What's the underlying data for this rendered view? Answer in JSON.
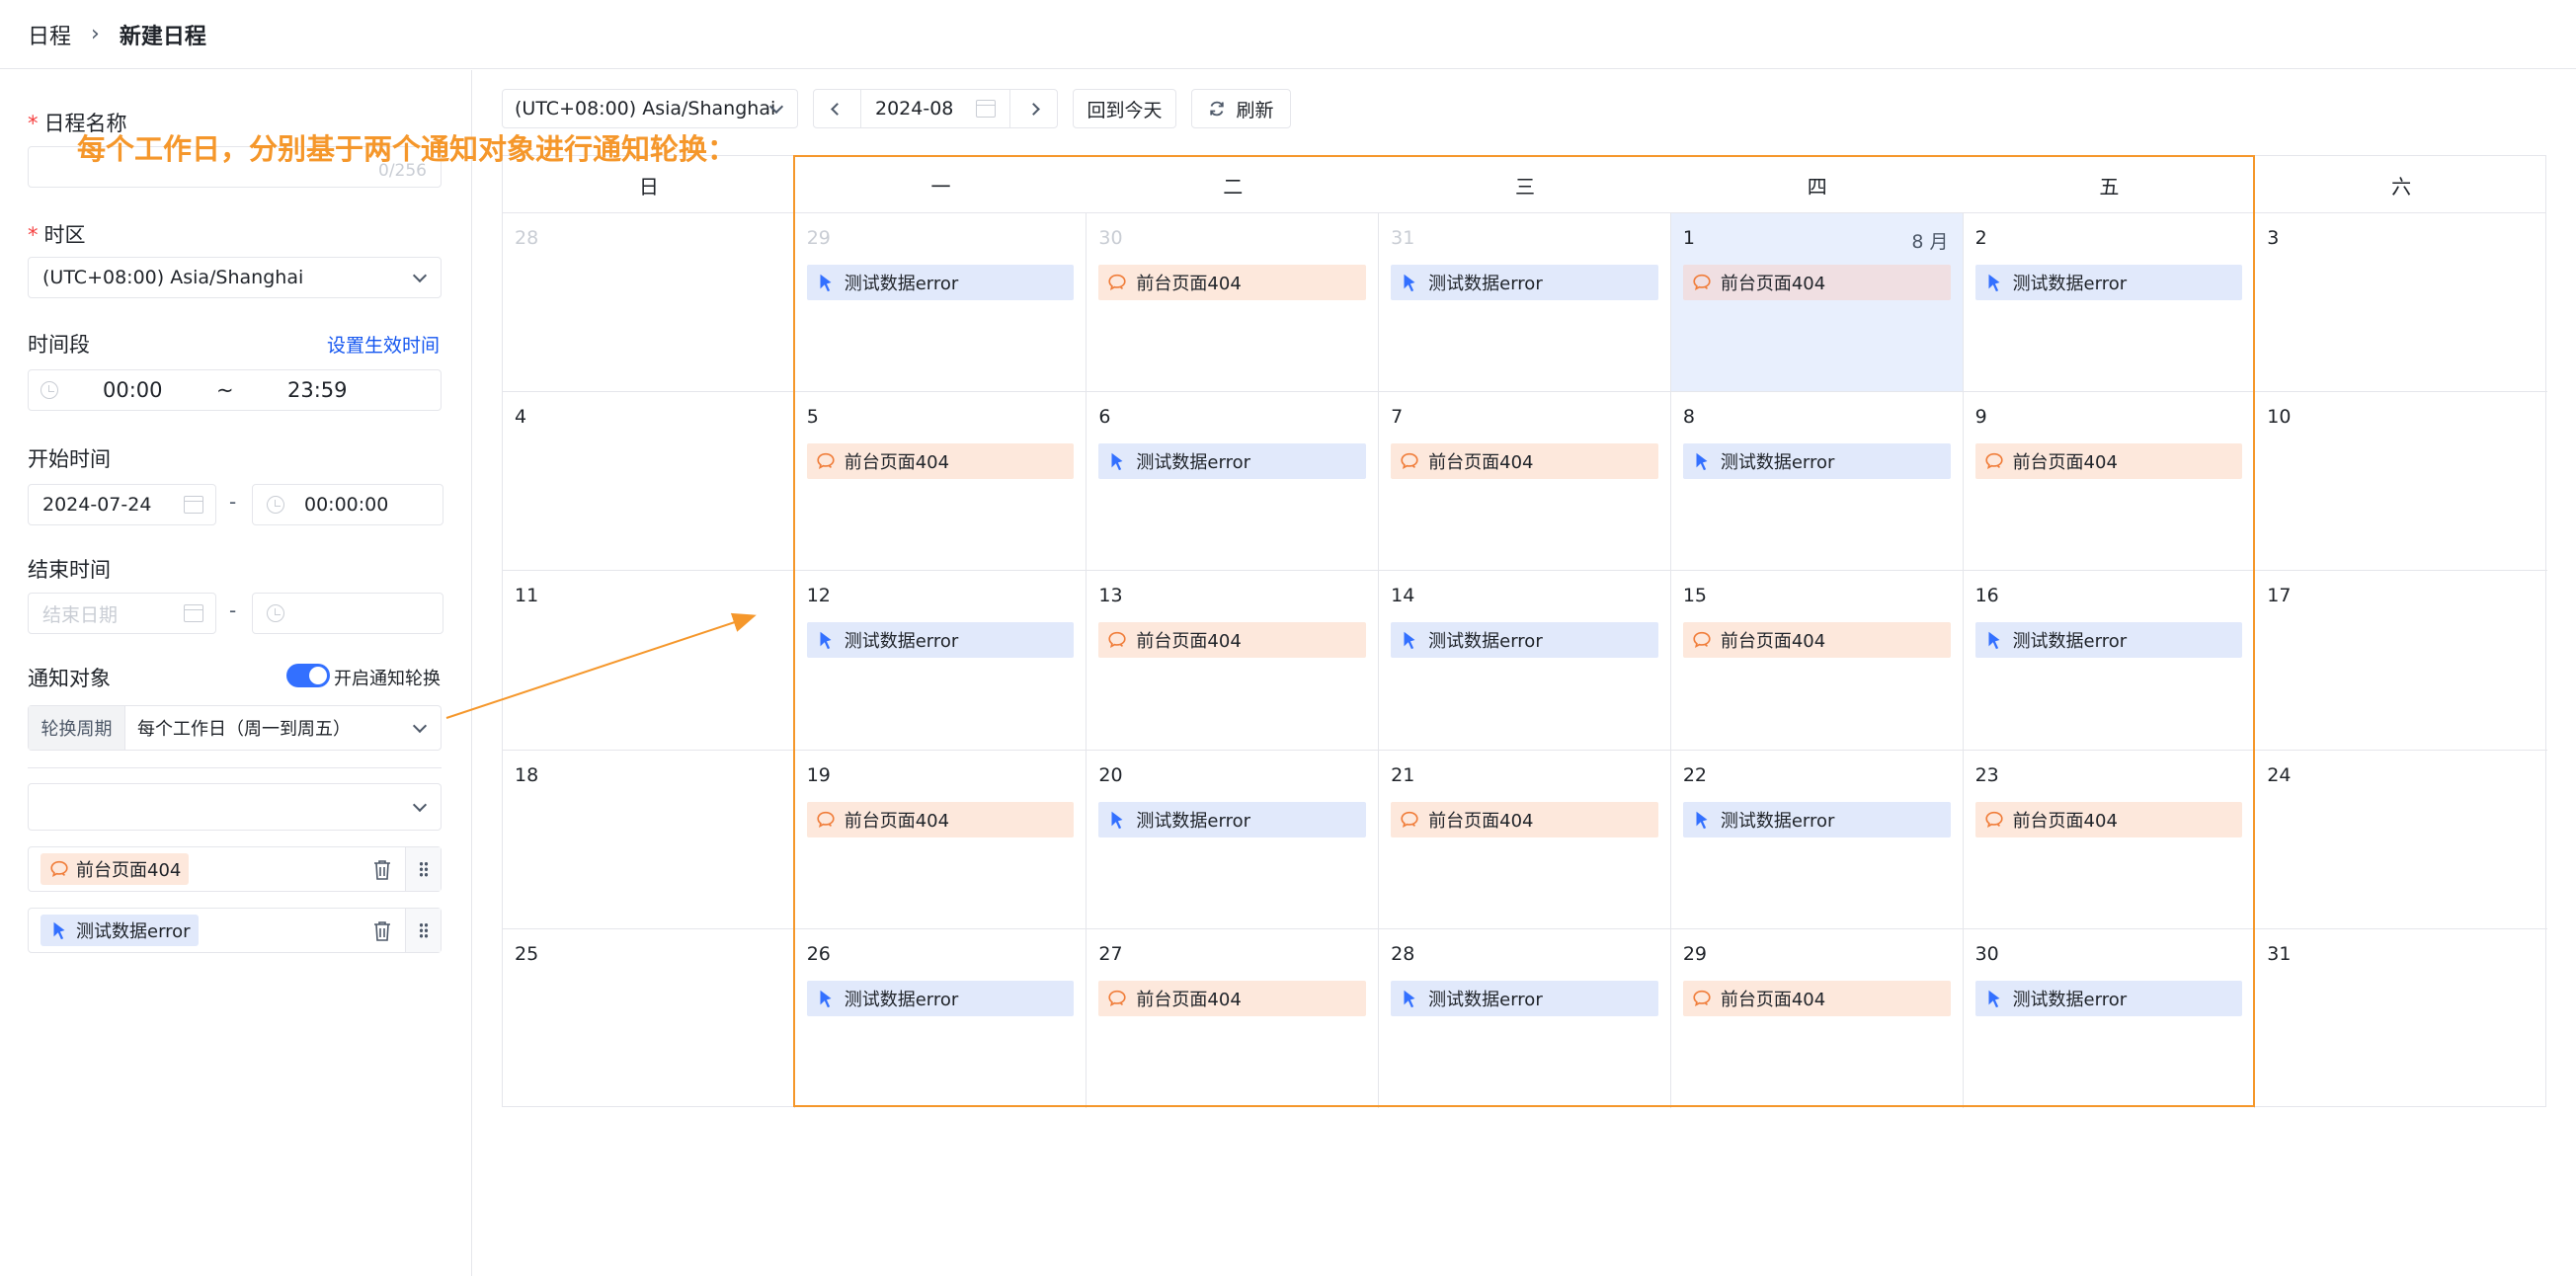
{
  "breadcrumb": {
    "root": "日程",
    "separator": "›",
    "current": "新建日程"
  },
  "form": {
    "name_label": "日程名称",
    "name_counter": "0/256",
    "timezone_label": "时区",
    "timezone_value": "(UTC+08:00) Asia/Shanghai",
    "period_label": "时间段",
    "period_link": "设置生效时间",
    "period_start": "00:00",
    "period_tilde": "~",
    "period_end": "23:59",
    "start_label": "开始时间",
    "start_date": "2024-07-24",
    "start_time": "00:00:00",
    "end_label": "结束时间",
    "end_date_placeholder": "结束日期",
    "dash": "-",
    "notify_label": "通知对象",
    "rotate_toggle_label": "开启通知轮换",
    "rotate_toggle_on": true,
    "cycle_label": "轮换周期",
    "cycle_value": "每个工作日（周一到周五）",
    "members": [
      {
        "name": "前台页面404",
        "kind": "chat",
        "color": "#f07d3a"
      },
      {
        "name": "测试数据error",
        "kind": "bot",
        "color": "#3370ff"
      }
    ]
  },
  "toolbar": {
    "timezone": "(UTC+08:00) Asia/Shanghai",
    "month": "2024-08",
    "today_label": "回到今天",
    "refresh_label": "刷新"
  },
  "annotation": "每个工作日，分别基于两个通知对象进行通知轮换：",
  "calendar": {
    "weekdays": [
      "日",
      "一",
      "二",
      "三",
      "四",
      "五",
      "六"
    ],
    "month_label": "8 月",
    "weeks": [
      [
        {
          "day": "28",
          "muted": true
        },
        {
          "day": "29",
          "muted": true,
          "event": "测试数据error",
          "kind": "bot"
        },
        {
          "day": "30",
          "muted": true,
          "event": "前台页面404",
          "kind": "chat"
        },
        {
          "day": "31",
          "muted": true,
          "event": "测试数据error",
          "kind": "bot"
        },
        {
          "day": "1",
          "today": true,
          "event": "前台页面404",
          "kind": "chat"
        },
        {
          "day": "2",
          "event": "测试数据error",
          "kind": "bot"
        },
        {
          "day": "3"
        }
      ],
      [
        {
          "day": "4"
        },
        {
          "day": "5",
          "event": "前台页面404",
          "kind": "chat"
        },
        {
          "day": "6",
          "event": "测试数据error",
          "kind": "bot"
        },
        {
          "day": "7",
          "event": "前台页面404",
          "kind": "chat"
        },
        {
          "day": "8",
          "event": "测试数据error",
          "kind": "bot"
        },
        {
          "day": "9",
          "event": "前台页面404",
          "kind": "chat"
        },
        {
          "day": "10"
        }
      ],
      [
        {
          "day": "11"
        },
        {
          "day": "12",
          "event": "测试数据error",
          "kind": "bot"
        },
        {
          "day": "13",
          "event": "前台页面404",
          "kind": "chat"
        },
        {
          "day": "14",
          "event": "测试数据error",
          "kind": "bot"
        },
        {
          "day": "15",
          "event": "前台页面404",
          "kind": "chat"
        },
        {
          "day": "16",
          "event": "测试数据error",
          "kind": "bot"
        },
        {
          "day": "17"
        }
      ],
      [
        {
          "day": "18"
        },
        {
          "day": "19",
          "event": "前台页面404",
          "kind": "chat"
        },
        {
          "day": "20",
          "event": "测试数据error",
          "kind": "bot"
        },
        {
          "day": "21",
          "event": "前台页面404",
          "kind": "chat"
        },
        {
          "day": "22",
          "event": "测试数据error",
          "kind": "bot"
        },
        {
          "day": "23",
          "event": "前台页面404",
          "kind": "chat"
        },
        {
          "day": "24"
        }
      ],
      [
        {
          "day": "25"
        },
        {
          "day": "26",
          "event": "测试数据error",
          "kind": "bot"
        },
        {
          "day": "27",
          "event": "前台页面404",
          "kind": "chat"
        },
        {
          "day": "28",
          "event": "测试数据error",
          "kind": "bot"
        },
        {
          "day": "29",
          "event": "前台页面404",
          "kind": "chat"
        },
        {
          "day": "30",
          "event": "测试数据error",
          "kind": "bot"
        },
        {
          "day": "31"
        }
      ]
    ]
  },
  "colors": {
    "accent": "#3370ff",
    "highlight": "#f5972b",
    "today_bg": "#e8effd"
  }
}
